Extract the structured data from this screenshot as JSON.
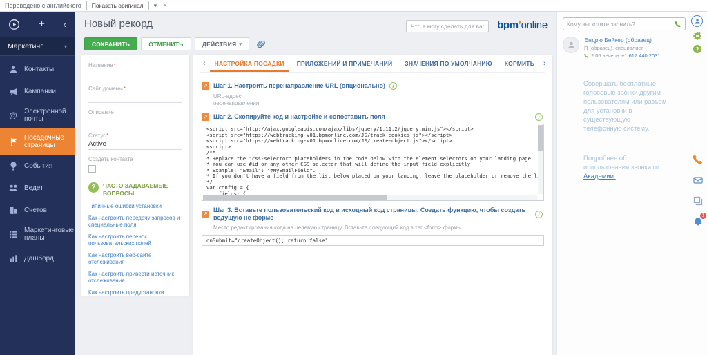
{
  "colors": {
    "sidebar_navy": "#22305a",
    "accent_orange": "#ec8433",
    "save_green": "#44ae4e",
    "link_blue": "#3e7fc1",
    "tab_orange": "#e87a2e",
    "badge_red": "#e2574c"
  },
  "icons": {
    "caret_down": "▾",
    "close": "×",
    "plus": "+",
    "chevron_left": "‹",
    "chevron_right": "›",
    "at": "@",
    "question": "?",
    "info": "i",
    "step_arrow": "↗",
    "required_marker": "*"
  },
  "translate_bar": {
    "status": "Переведено с английского",
    "show_original": "Показать оригинал"
  },
  "logo": {
    "bpm": "bpm",
    "apos": "’",
    "online": "online"
  },
  "sidebar": {
    "workspace": "Маркетинг",
    "items": [
      {
        "label": "Контакты"
      },
      {
        "label": "Кампании"
      },
      {
        "label": "Электронной почты"
      },
      {
        "label": "Посадочные страницы"
      },
      {
        "label": "События"
      },
      {
        "label": "Ведет"
      },
      {
        "label": "Счетов"
      },
      {
        "label": "Маркетинговые планы"
      },
      {
        "label": "Дашборд"
      }
    ]
  },
  "header": {
    "title": "Новый рекорд",
    "command_placeholder": "Что я могу сделать для вас?"
  },
  "toolbar": {
    "save": "СОХРАНИТЬ",
    "cancel": "ОТМЕНИТЬ",
    "actions": "ДЕЙСТВИЯ"
  },
  "form": {
    "fields": {
      "name_label": "Название",
      "domain_label": "Сайт домены",
      "description_label": "Описание",
      "status_label": "Статус",
      "status_value": "Active",
      "create_contact_label": "Создать контакта"
    },
    "faq": {
      "title": "ЧАСТО ЗАДАВАЕМЫЕ ВОПРОСЫ",
      "links": [
        "Типичные ошибки установки",
        "Как настроить передачу запросов и специальные поля",
        "Как настроить перенос пользовательских полей",
        "Как настроить веб-сайте отслеживания",
        "Как настроить привести источник отслеживания",
        "Как настроить предустановки форма"
      ]
    }
  },
  "tabs": [
    "НАСТРОЙКА ПОСАДКИ",
    "ПРИЛОЖЕНИЙ И ПРИМЕЧАНИЙ",
    "ЗНАЧЕНИЯ ПО УМОЛЧАНИЮ",
    "КОРМИТЬ"
  ],
  "steps": {
    "step1": {
      "title": "Шаг 1. Настроить перенаправление URL (опционально)",
      "url_label": "URL-адрес перенаправления"
    },
    "step2": {
      "title": "Шаг 2. Скопируйте код и настройте и сопоставить поля",
      "code": [
        "<script src=\"http://ajax.googleapis.com/ajax/libs/jquery/1.11.2/jquery.min.js\"></script>",
        "<script src=\"https://webtracking-v01.bpmonline.com/JS/track-cookies.js\"></script>",
        "<script src=\"https://webtracking-v01.bpmonline.com/JS/create-object.js\"></script>",
        "<script>",
        "/**",
        "* Replace the \"css-selector\" placeholders in the code below with the element selectors on your landing page.",
        "* You can use #id or any other CSS selector that will define the input field explicitly.",
        "* Example: \"Email\": \"#MyEmailField\".",
        "* If you don't have a field from the list below placed on your landing, leave the placeholder or remove the line.",
        "*/",
        "var config = {",
        "    fields: {",
        "        \"Name\": \"css-selector\"   // Name of a visitor, submitting the page"
      ]
    },
    "step3": {
      "title": "Шаг 3. Вставьте пользовательский код в исходный код страницы. Создать функцию, чтобы создать ведущую не форме",
      "hint": "Место редактирования кода на целевую страницу. Вставьте следующий код в тег <form> формы.",
      "code": "onSubmit=\"createObject(); return false\""
    }
  },
  "call_panel": {
    "call_placeholder": "Кому вы хотите звонить?",
    "user_name": "Эндрю Бейкер (образец)",
    "user_role": "П (образец), специалист",
    "user_time": "2:06 вечера",
    "user_phone": "+1 617 440 2031",
    "info_text": "Совершать бесплатные голосовые звонки другим пользователям или разъем для установки в существующую телефонную систему.",
    "more_text": "Подробнее об использования звонки от",
    "more_link": "Академии.",
    "notification_count": "1"
  }
}
